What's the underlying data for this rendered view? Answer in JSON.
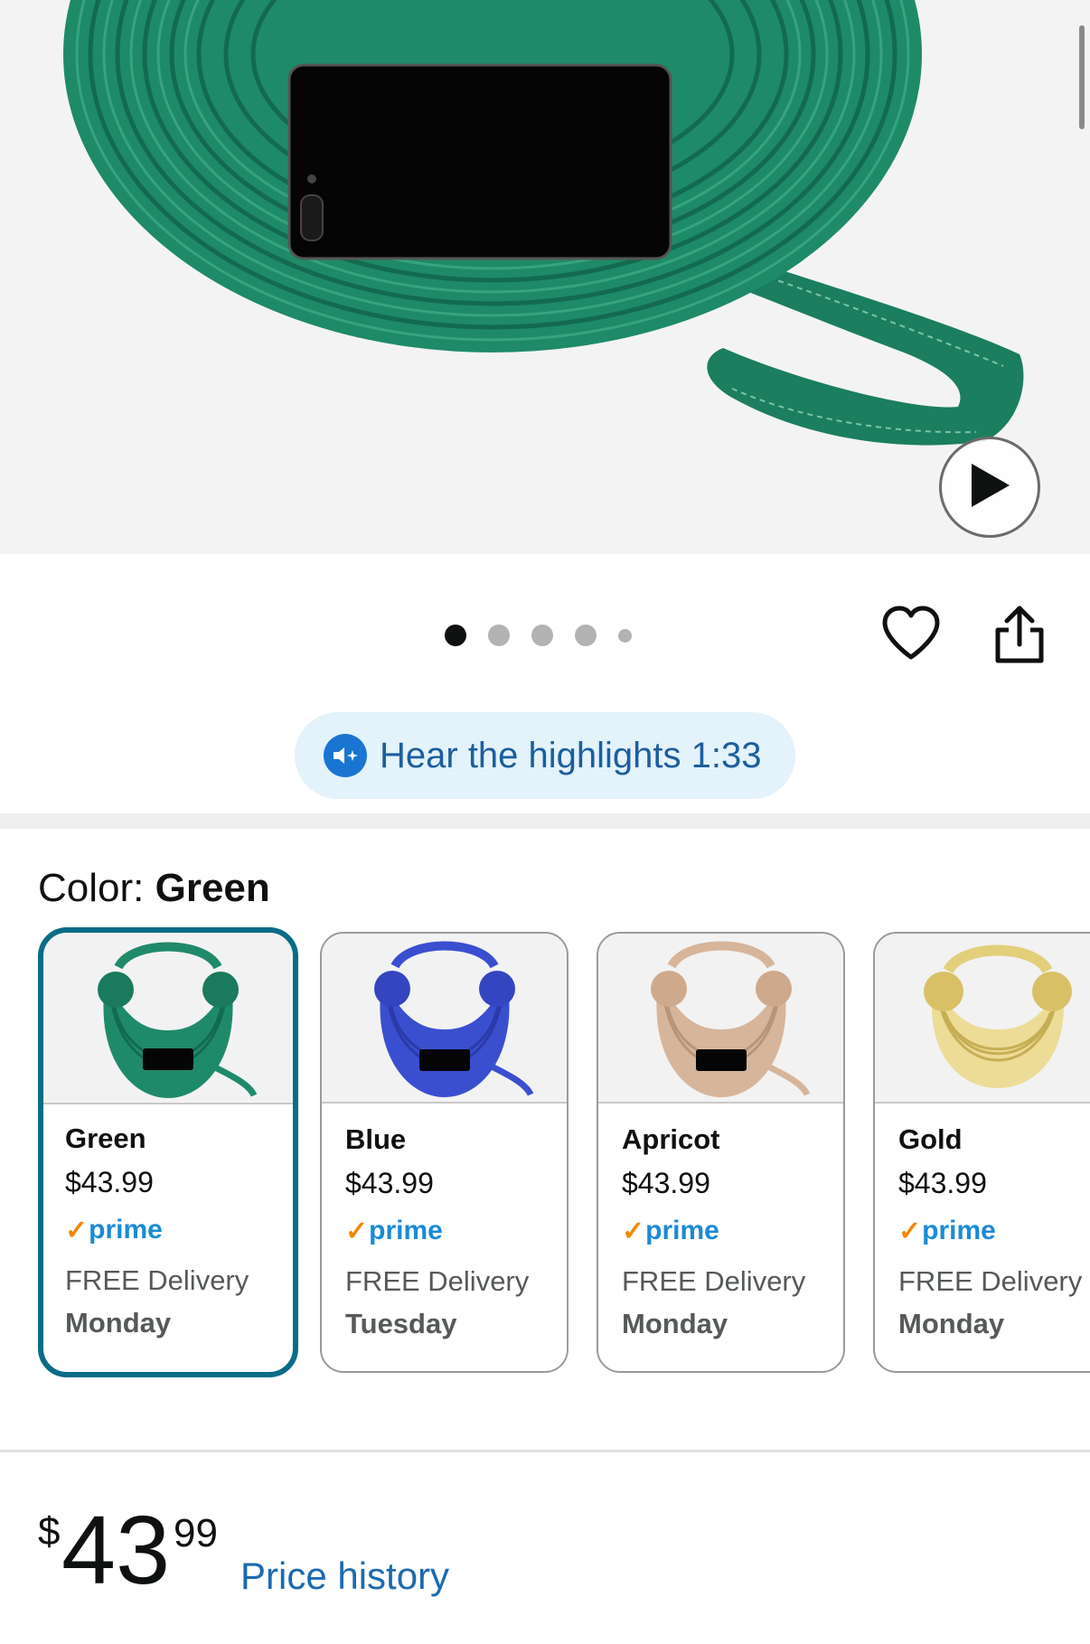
{
  "product": {
    "media": {
      "play_icon": "play-icon",
      "pager_count": 5,
      "active_index": 0
    },
    "actions": {
      "favorite_icon": "heart-icon",
      "share_icon": "share-icon"
    },
    "highlights": {
      "label": "Hear the highlights",
      "duration": "1:33",
      "icon": "audio-sparkle-icon"
    },
    "color": {
      "label": "Color: ",
      "value": "Green"
    },
    "variants": [
      {
        "name": "Green",
        "price": "$43.99",
        "prime": "prime",
        "delivery": "FREE Delivery",
        "day": "Monday",
        "selected": true,
        "color": "#1f8a6a"
      },
      {
        "name": "Blue",
        "price": "$43.99",
        "prime": "prime",
        "delivery": "FREE Delivery",
        "day": "Tuesday",
        "selected": false,
        "color": "#3a4fcf"
      },
      {
        "name": "Apricot",
        "price": "$43.99",
        "prime": "prime",
        "delivery": "FREE Delivery",
        "day": "Monday",
        "selected": false,
        "color": "#d7b59a"
      },
      {
        "name": "Gold",
        "price": "$43.99",
        "prime": "prime",
        "delivery": "FREE Delivery",
        "day": "Monday",
        "selected": false,
        "color": "#e3cf7a"
      }
    ],
    "price": {
      "symbol": "$",
      "whole": "43",
      "fraction": "99",
      "history_link": "Price history"
    }
  },
  "colors": {
    "selected_border": "#0a6c86",
    "prime_blue": "#1a8ad6",
    "prime_check": "#f08804",
    "link_blue": "#1b6ab0",
    "pill_bg": "#e3f2fb"
  }
}
